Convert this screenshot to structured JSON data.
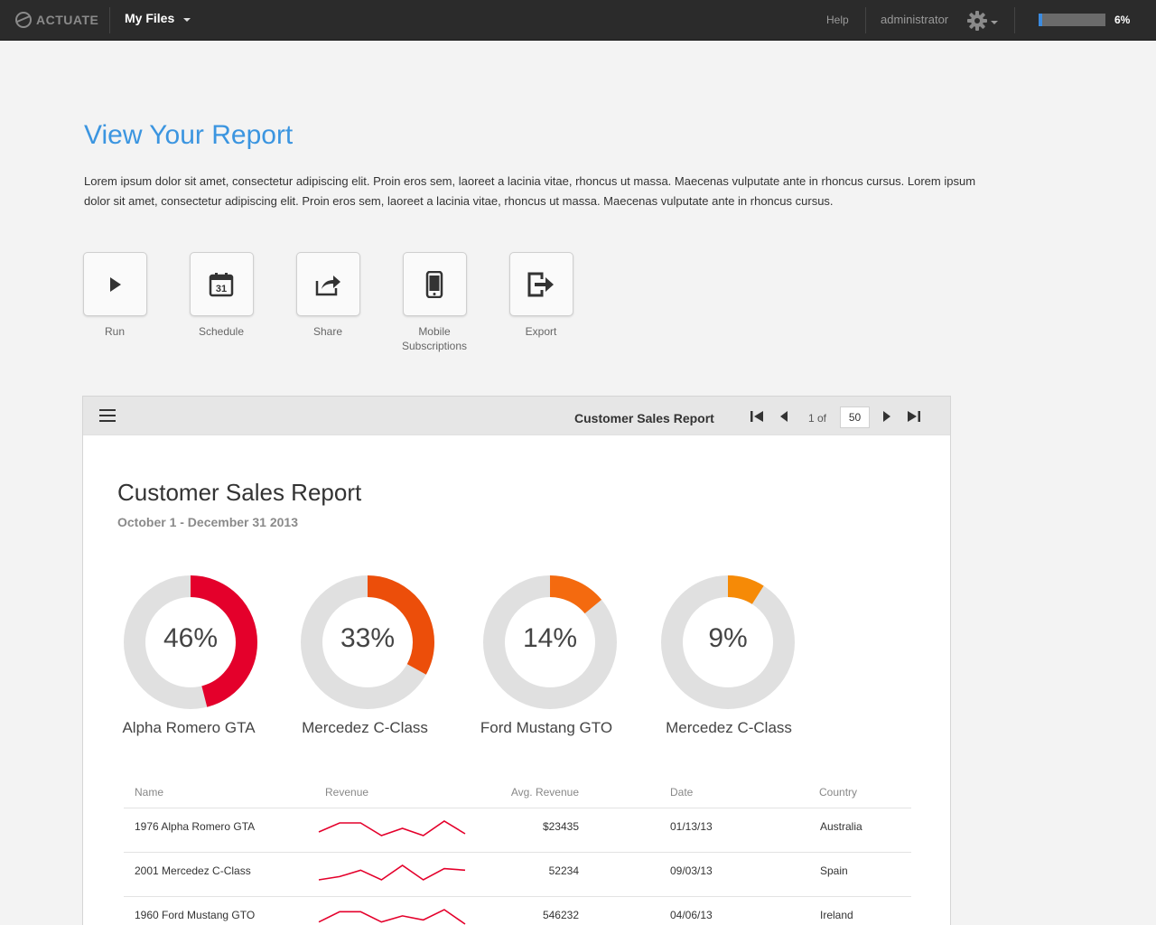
{
  "topbar": {
    "logo": "ACTUATE",
    "menu_label": "My Files",
    "help": "Help",
    "user": "administrator",
    "progress_pct": 6,
    "progress_label": "6%",
    "icons": [
      "actuate-logo-icon",
      "chevron-down-icon",
      "gear-icon"
    ]
  },
  "page": {
    "title": "View Your Report",
    "description": "Lorem ipsum dolor sit amet, consectetur adipiscing elit. Proin eros sem, laoreet a lacinia vitae, rhoncus ut massa. Maecenas vulputate ante in rhoncus cursus. Lorem ipsum dolor sit amet, consectetur adipiscing elit. Proin eros sem, laoreet a lacinia vitae, rhoncus ut massa. Maecenas vulputate ante in rhoncus cursus."
  },
  "actions": [
    {
      "label": "Run",
      "icon": "play-icon"
    },
    {
      "label": "Schedule",
      "icon": "calendar-icon",
      "icon_text": "31"
    },
    {
      "label": "Share",
      "icon": "share-icon"
    },
    {
      "label": "Mobile Subscriptions",
      "icon": "mobile-icon"
    },
    {
      "label": "Export",
      "icon": "export-icon"
    }
  ],
  "viewer": {
    "toolbar_title": "Customer Sales Report",
    "page_of": "1 of",
    "page_total": "50",
    "icons": [
      "menu-icon",
      "first-page-icon",
      "prev-page-icon",
      "next-page-icon",
      "last-page-icon"
    ]
  },
  "report": {
    "title": "Customer Sales Report",
    "subtitle": "October 1 - December 31 2013"
  },
  "chart_data": {
    "type": "pie",
    "variant": "donut",
    "items": [
      {
        "label": "46%",
        "value": 46,
        "name": "Alpha Romero GTA",
        "color": "#e4002b"
      },
      {
        "label": "33%",
        "value": 33,
        "name": "Mercedez C-Class",
        "color": "#ec4e0a"
      },
      {
        "label": "14%",
        "value": 14,
        "name": "Ford Mustang GTO",
        "color": "#f46a0f"
      },
      {
        "label": "9%",
        "value": 9,
        "name": "Mercedez C-Class",
        "color": "#f68a06"
      }
    ],
    "track_color": "#e0e0e0"
  },
  "table": {
    "headers": {
      "name": "Name",
      "revenue": "Revenue",
      "avg": "Avg. Revenue",
      "date": "Date",
      "country": "Country"
    },
    "sparkline_color": "#e4002b",
    "rows": [
      {
        "name": "1976 Alpha Romero GTA",
        "avg": "$23435",
        "date": "01/13/13",
        "country": "Australia",
        "spark": [
          2,
          7,
          7,
          0,
          4,
          0,
          8,
          1
        ]
      },
      {
        "name": "2001 Mercedez C-Class",
        "avg": "52234",
        "date": "09/03/13",
        "country": "Spain",
        "spark": [
          0,
          2,
          6,
          0,
          9,
          0,
          7,
          6
        ]
      },
      {
        "name": "1960 Ford Mustang GTO",
        "avg": "546232",
        "date": "04/06/13",
        "country": "Ireland",
        "spark": [
          2,
          7,
          7,
          2,
          5,
          3,
          8,
          1
        ]
      }
    ]
  }
}
